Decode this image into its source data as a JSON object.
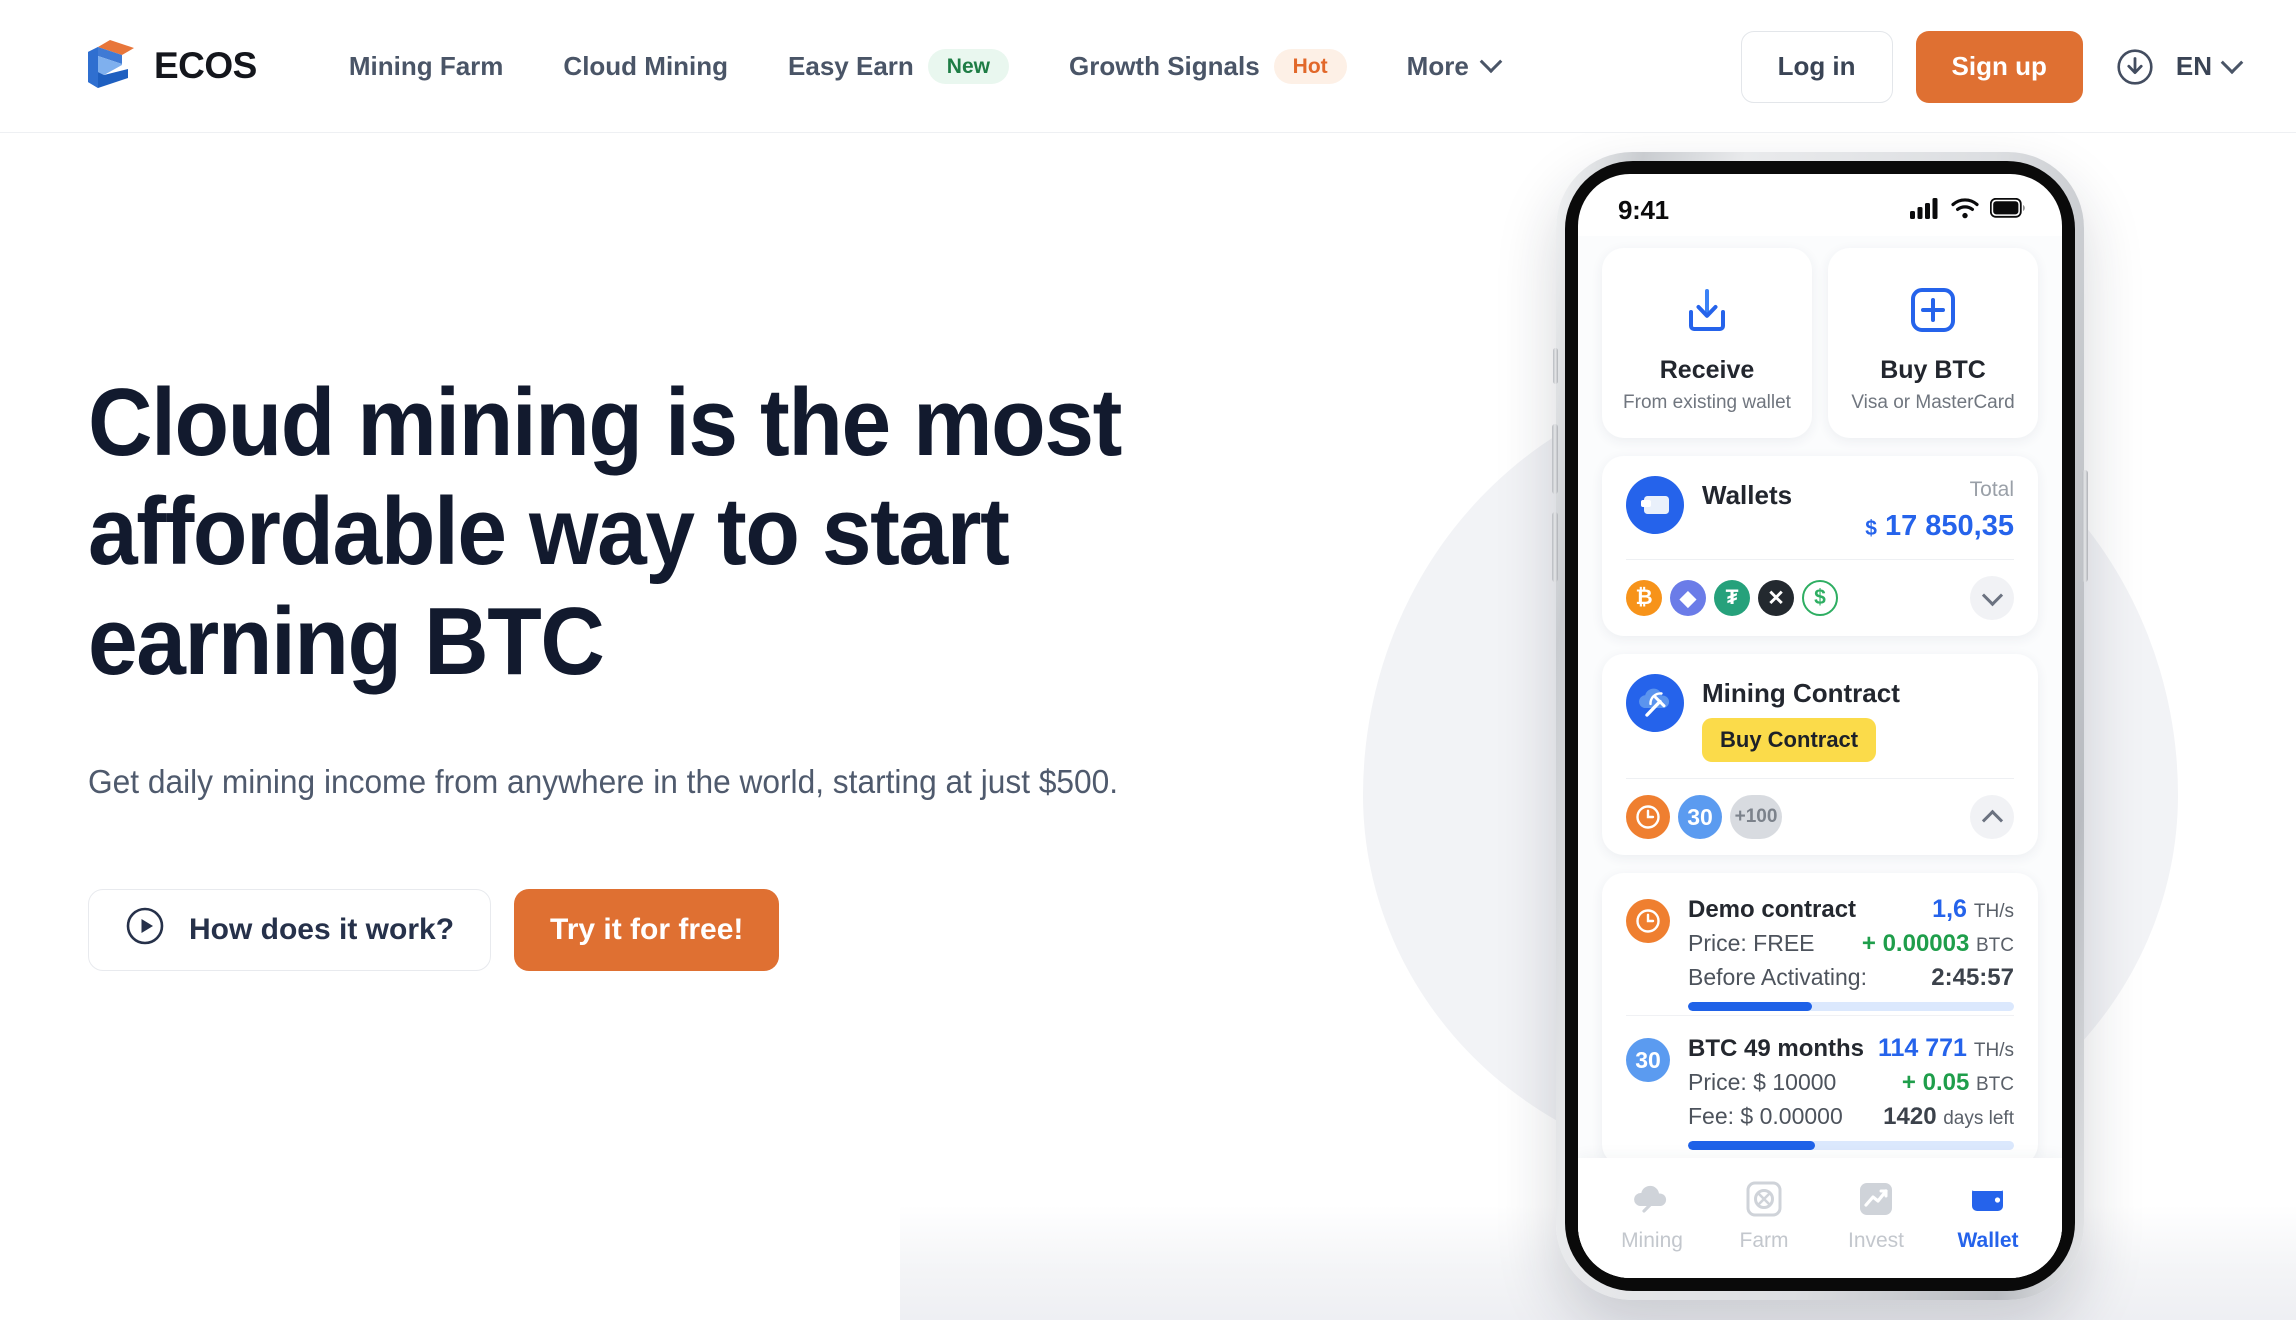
{
  "header": {
    "brand": "ECOS",
    "nav": [
      {
        "label": "Mining Farm",
        "badge": null
      },
      {
        "label": "Cloud Mining",
        "badge": null
      },
      {
        "label": "Easy Earn",
        "badge": "New",
        "badge_kind": "new"
      },
      {
        "label": "Growth Signals",
        "badge": "Hot",
        "badge_kind": "hot"
      },
      {
        "label": "More",
        "badge": null,
        "caret": true
      }
    ],
    "login_label": "Log in",
    "signup_label": "Sign up",
    "download_icon": "download-circle-icon",
    "language": "EN"
  },
  "hero": {
    "title": "Cloud mining is the most affordable way to start earning BTC",
    "subtitle": "Get daily mining income from anywhere in the world, starting at just $500.",
    "cta_secondary": "How does it work?",
    "cta_primary": "Try it for free!"
  },
  "phone": {
    "status": {
      "time": "9:41",
      "signal_icon": "cellular-bars-icon",
      "wifi_icon": "wifi-icon",
      "battery_icon": "battery-full-icon"
    },
    "actions": [
      {
        "icon": "download-tray-icon",
        "title": "Receive",
        "subtitle": "From existing wallet"
      },
      {
        "icon": "plus-square-icon",
        "title": "Buy BTC",
        "subtitle": "Visa or MasterCard"
      }
    ],
    "wallets": {
      "icon": "wallet-icon",
      "title": "Wallets",
      "total_label": "Total",
      "currency": "$",
      "total_amount": "17 850,35",
      "coins": [
        "BTC",
        "ETH",
        "USDT",
        "XRP",
        "USD"
      ],
      "expand_icon": "chevron-down-icon"
    },
    "mining_contract": {
      "icon": "pickaxe-cloud-icon",
      "title": "Mining Contract",
      "buy_label": "Buy Contract",
      "chip_clock": "clock-icon",
      "chip_30": "30",
      "chip_more": "+100",
      "collapse_icon": "chevron-up-icon"
    },
    "contracts": [
      {
        "badge_kind": "clock",
        "badge_text": "",
        "name": "Demo contract",
        "price_label": "Price: FREE",
        "third_label": "Before Activating:",
        "hashrate": "1,6",
        "hashrate_unit": "TH/s",
        "reward_sign": "+ 0.00003",
        "reward_unit": "BTC",
        "third_value": "2:45:57",
        "third_value_unit": "",
        "progress_pct": 38
      },
      {
        "badge_kind": "num",
        "badge_text": "30",
        "name": "BTC 49 months",
        "price_label": "Price: $ 10000",
        "third_label": "Fee: $ 0.00000",
        "hashrate": "114 771",
        "hashrate_unit": "TH/s",
        "reward_sign": "+  0.05",
        "reward_unit": "BTC",
        "third_value": "1420",
        "third_value_unit": "days left",
        "progress_pct": 39
      }
    ],
    "tabs": [
      {
        "label": "Mining",
        "icon": "cloud-mining-icon",
        "active": false
      },
      {
        "label": "Farm",
        "icon": "farm-icon",
        "active": false
      },
      {
        "label": "Invest",
        "icon": "chart-invest-icon",
        "active": false
      },
      {
        "label": "Wallet",
        "icon": "wallet-tab-icon",
        "active": true
      }
    ]
  },
  "colors": {
    "accent_orange": "#df7032",
    "brand_dark": "#121a2e",
    "nav_text": "#4a5567",
    "blue": "#2563eb",
    "green": "#1f9e4b",
    "yellow": "#fbdb4a"
  }
}
